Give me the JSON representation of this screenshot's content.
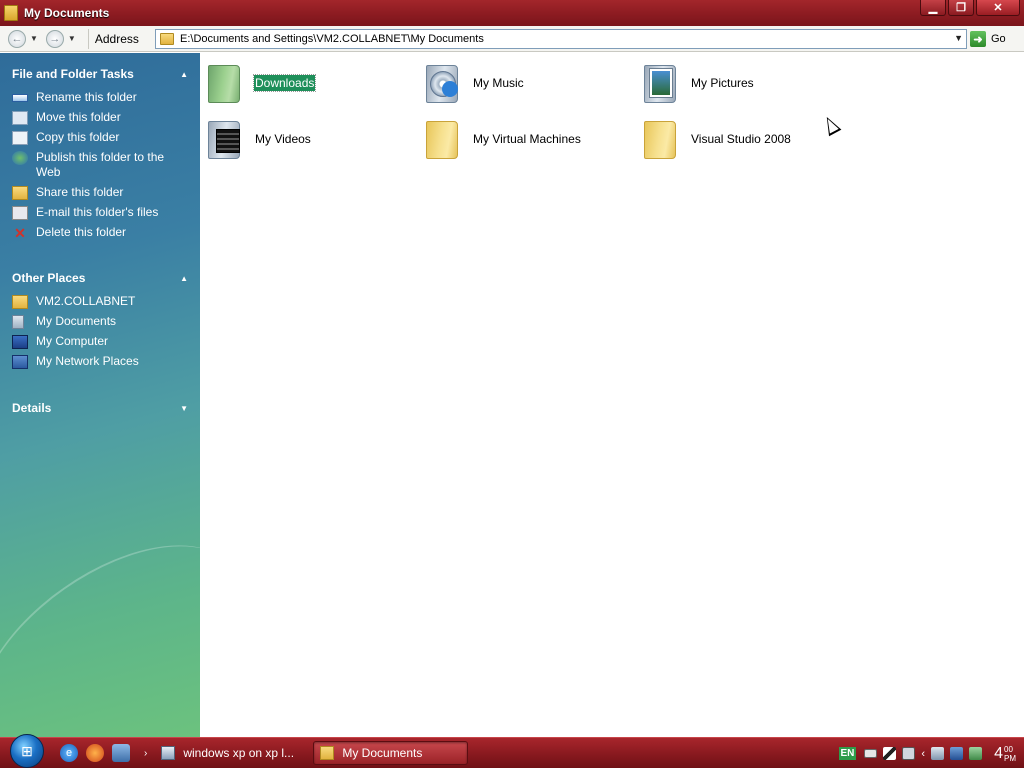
{
  "window": {
    "title": "My Documents"
  },
  "window_controls": {
    "minimize": "▁",
    "restore": "❐",
    "close": "✕"
  },
  "toolbar": {
    "back_icon": "←",
    "forward_icon": "→",
    "address_label": "Address",
    "address_value": "E:\\Documents and Settings\\VM2.COLLABNET\\My Documents",
    "go_label": "Go"
  },
  "taskpane": {
    "file_folder_tasks": {
      "title": "File and Folder Tasks",
      "items": [
        {
          "label": "Rename this folder",
          "icon": "rename-icon"
        },
        {
          "label": "Move this folder",
          "icon": "move-icon"
        },
        {
          "label": "Copy this folder",
          "icon": "copy-icon"
        },
        {
          "label": "Publish this folder to the Web",
          "icon": "publish-icon"
        },
        {
          "label": "Share this folder",
          "icon": "share-icon"
        },
        {
          "label": "E-mail this folder's files",
          "icon": "email-icon"
        },
        {
          "label": "Delete this folder",
          "icon": "delete-icon"
        }
      ]
    },
    "other_places": {
      "title": "Other Places",
      "items": [
        {
          "label": "VM2.COLLABNET",
          "icon": "folder-icon"
        },
        {
          "label": "My Documents",
          "icon": "documents-icon"
        },
        {
          "label": "My Computer",
          "icon": "computer-icon"
        },
        {
          "label": "My Network Places",
          "icon": "network-icon"
        }
      ]
    },
    "details": {
      "title": "Details"
    }
  },
  "content": {
    "items": [
      {
        "label": "Downloads",
        "icon": "green-folder-icon",
        "selected": true
      },
      {
        "label": "My Music",
        "icon": "music-folder-icon"
      },
      {
        "label": "My Pictures",
        "icon": "pictures-folder-icon"
      },
      {
        "label": "My Videos",
        "icon": "videos-folder-icon"
      },
      {
        "label": "My Virtual Machines",
        "icon": "folder-icon"
      },
      {
        "label": "Visual Studio 2008",
        "icon": "folder-icon"
      }
    ]
  },
  "taskbar": {
    "tasks": [
      {
        "label": "windows xp on xp l...",
        "active": false
      },
      {
        "label": "My Documents",
        "active": true
      }
    ],
    "tray": {
      "language": "EN",
      "time_hour": "4",
      "time_minutes": "00",
      "time_ampm": "PM"
    }
  },
  "colors": {
    "titlebar": "#8e1c22",
    "taskpane_top": "#2f6c9a",
    "taskpane_bottom": "#6cc27e",
    "selection": "#1e8f5a"
  }
}
